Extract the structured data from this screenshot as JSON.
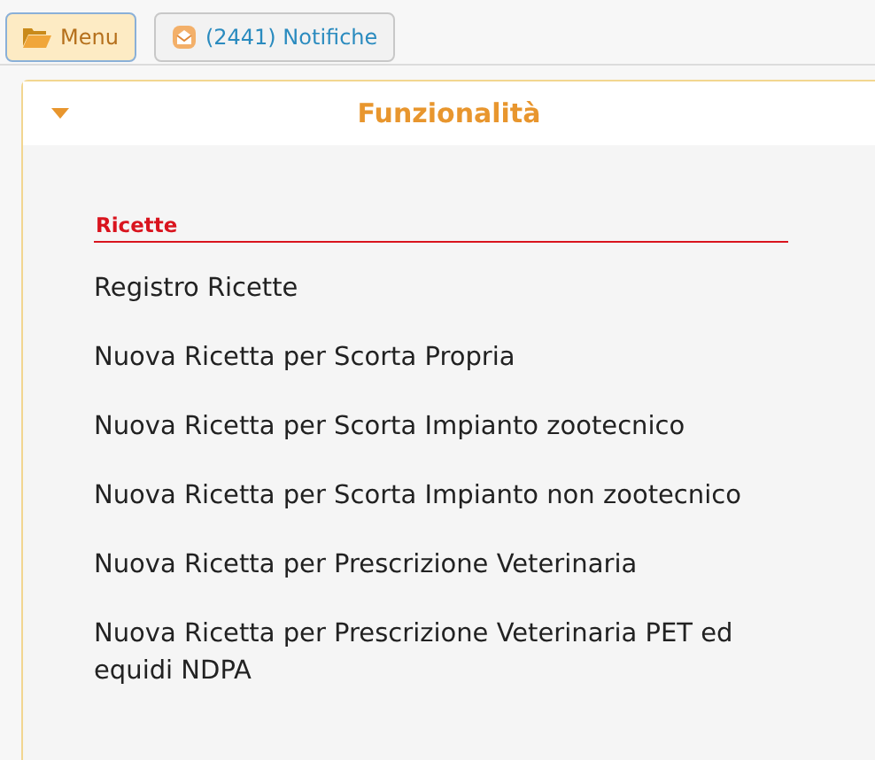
{
  "toolbar": [
    {
      "kind": "menu",
      "label": "Menu",
      "selected": true
    },
    {
      "kind": "notifications",
      "label": "(2441) Notifiche",
      "selected": false
    }
  ],
  "panel": {
    "title": "Funzionalità",
    "expanded": true,
    "section": "Ricette",
    "items": [
      "Registro Ricette",
      "Nuova Ricetta per Scorta Propria",
      "Nuova Ricetta per Scorta Impianto zootecnico",
      "Nuova Ricetta per Scorta Impianto non zootecnico",
      "Nuova Ricetta per Prescrizione Veterinaria",
      "Nuova Ricetta per Prescrizione Veterinaria PET ed equidi NDPA"
    ]
  }
}
